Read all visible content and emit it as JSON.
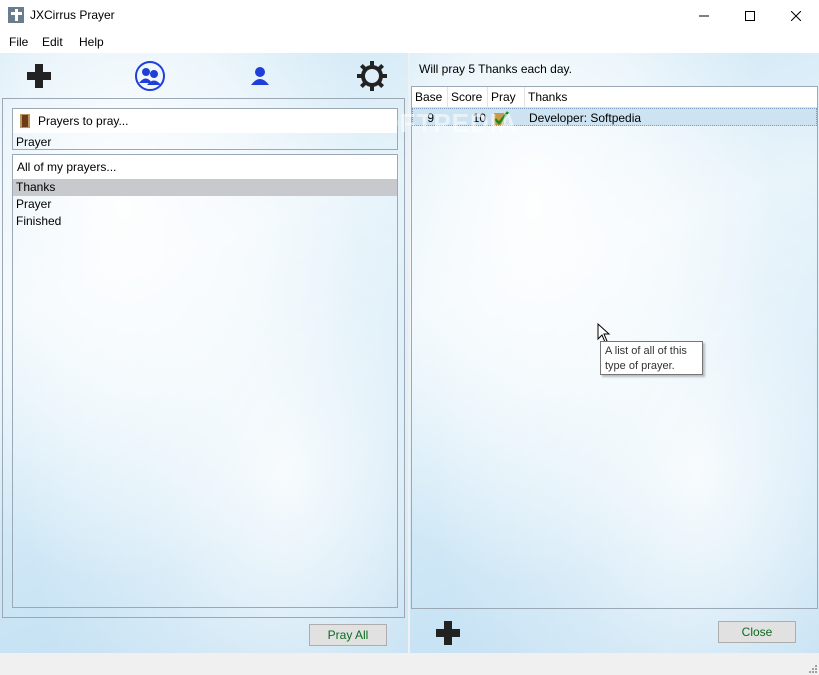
{
  "window": {
    "title": "JXCirrus Prayer",
    "minimize": "—",
    "maximize": "☐",
    "close": "✕"
  },
  "menu": {
    "file": "File",
    "edit": "Edit",
    "help": "Help"
  },
  "left": {
    "pray_header": "Prayers to pray...",
    "pray_value": "Prayer",
    "list_header": "All of my prayers...",
    "items": [
      "Thanks",
      "Prayer",
      "Finished"
    ],
    "selected_index": 0,
    "pray_all_label": "Pray All"
  },
  "right": {
    "header": "Will pray 5 Thanks each day.",
    "columns": [
      "Base",
      "Score",
      "Pray",
      "Thanks"
    ],
    "rows": [
      {
        "base": "9",
        "score": "10",
        "pray": true,
        "thanks": "Developer: Softpedia"
      }
    ],
    "close_label": "Close"
  },
  "tooltip": {
    "line1": "A list of all of this",
    "line2": "type of prayer."
  },
  "watermark": "SOFTPEDIA",
  "colors": {
    "accent": "#1f3fd8",
    "button_text": "#0b6b1f",
    "selection": "#c7c9cc",
    "row_selection": "#cde3f2"
  }
}
